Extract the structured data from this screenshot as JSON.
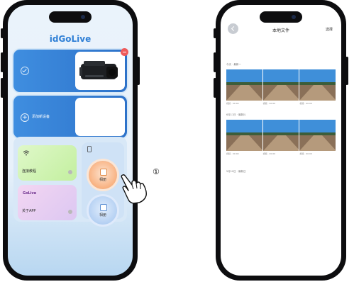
{
  "left_phone": {
    "app_title": "idGoLive",
    "device_card": {
      "status_icon": "check-circle-icon",
      "remove_icon": "minus-icon"
    },
    "add_card": {
      "label": "添加新设备",
      "icon": "plus-circle-icon"
    },
    "tiles": {
      "tutorial": {
        "label": "连接教程",
        "icon": "wifi-icon"
      },
      "about": {
        "label": "关于APP",
        "logo": "GoLive"
      }
    },
    "round_buttons": {
      "album": {
        "label": "相册"
      },
      "record": {
        "label": "相册"
      }
    }
  },
  "annotation": {
    "step": "①"
  },
  "right_phone": {
    "title": "本地文件",
    "select": "选择",
    "groups": [
      {
        "date": "今天 · 最新一",
        "captions": [
          "视频 · 00:00",
          "视频 · 00:00",
          "视频 · 00:00"
        ]
      },
      {
        "date": "6月11日 · 最新片",
        "captions": [
          "视频 · 00:00",
          "视频 · 00:00",
          "视频 · 00:00"
        ]
      },
      {
        "date": "5月10日 · 最新日",
        "captions": []
      }
    ]
  },
  "colors": {
    "accent": "#2f7fd6",
    "card_blue": "#3b88dc",
    "badge_red": "#ef5a5a",
    "orange": "#f7a36a"
  }
}
